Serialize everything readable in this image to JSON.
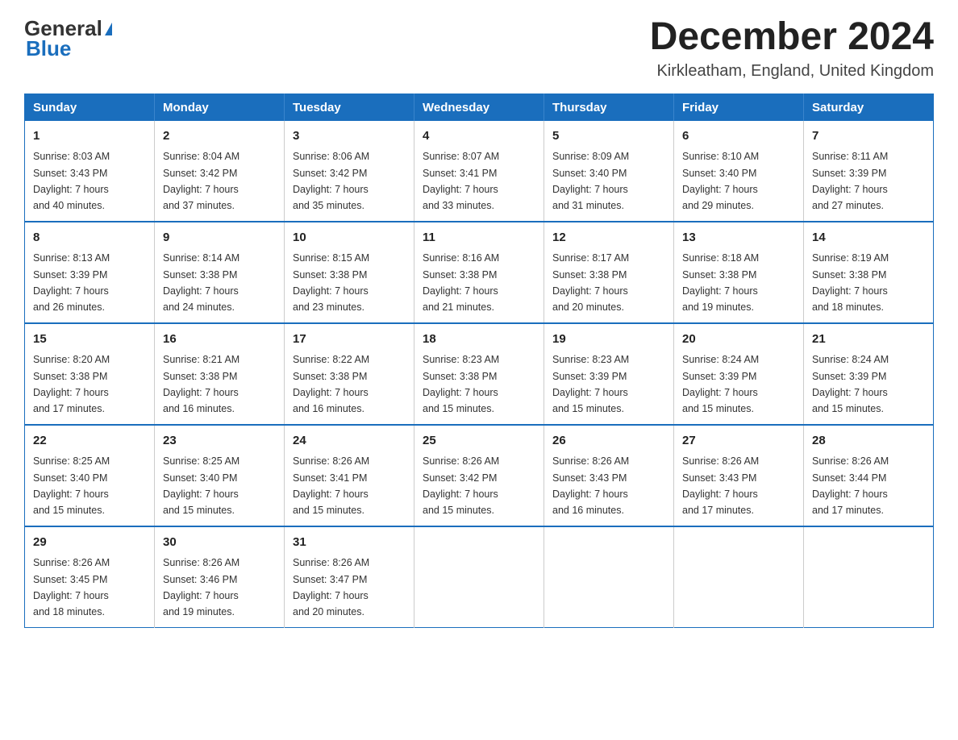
{
  "logo": {
    "general": "General",
    "blue": "Blue"
  },
  "header": {
    "month_year": "December 2024",
    "location": "Kirkleatham, England, United Kingdom"
  },
  "days_of_week": [
    "Sunday",
    "Monday",
    "Tuesday",
    "Wednesday",
    "Thursday",
    "Friday",
    "Saturday"
  ],
  "weeks": [
    [
      {
        "day": "1",
        "sunrise": "Sunrise: 8:03 AM",
        "sunset": "Sunset: 3:43 PM",
        "daylight": "Daylight: 7 hours",
        "minutes": "and 40 minutes."
      },
      {
        "day": "2",
        "sunrise": "Sunrise: 8:04 AM",
        "sunset": "Sunset: 3:42 PM",
        "daylight": "Daylight: 7 hours",
        "minutes": "and 37 minutes."
      },
      {
        "day": "3",
        "sunrise": "Sunrise: 8:06 AM",
        "sunset": "Sunset: 3:42 PM",
        "daylight": "Daylight: 7 hours",
        "minutes": "and 35 minutes."
      },
      {
        "day": "4",
        "sunrise": "Sunrise: 8:07 AM",
        "sunset": "Sunset: 3:41 PM",
        "daylight": "Daylight: 7 hours",
        "minutes": "and 33 minutes."
      },
      {
        "day": "5",
        "sunrise": "Sunrise: 8:09 AM",
        "sunset": "Sunset: 3:40 PM",
        "daylight": "Daylight: 7 hours",
        "minutes": "and 31 minutes."
      },
      {
        "day": "6",
        "sunrise": "Sunrise: 8:10 AM",
        "sunset": "Sunset: 3:40 PM",
        "daylight": "Daylight: 7 hours",
        "minutes": "and 29 minutes."
      },
      {
        "day": "7",
        "sunrise": "Sunrise: 8:11 AM",
        "sunset": "Sunset: 3:39 PM",
        "daylight": "Daylight: 7 hours",
        "minutes": "and 27 minutes."
      }
    ],
    [
      {
        "day": "8",
        "sunrise": "Sunrise: 8:13 AM",
        "sunset": "Sunset: 3:39 PM",
        "daylight": "Daylight: 7 hours",
        "minutes": "and 26 minutes."
      },
      {
        "day": "9",
        "sunrise": "Sunrise: 8:14 AM",
        "sunset": "Sunset: 3:38 PM",
        "daylight": "Daylight: 7 hours",
        "minutes": "and 24 minutes."
      },
      {
        "day": "10",
        "sunrise": "Sunrise: 8:15 AM",
        "sunset": "Sunset: 3:38 PM",
        "daylight": "Daylight: 7 hours",
        "minutes": "and 23 minutes."
      },
      {
        "day": "11",
        "sunrise": "Sunrise: 8:16 AM",
        "sunset": "Sunset: 3:38 PM",
        "daylight": "Daylight: 7 hours",
        "minutes": "and 21 minutes."
      },
      {
        "day": "12",
        "sunrise": "Sunrise: 8:17 AM",
        "sunset": "Sunset: 3:38 PM",
        "daylight": "Daylight: 7 hours",
        "minutes": "and 20 minutes."
      },
      {
        "day": "13",
        "sunrise": "Sunrise: 8:18 AM",
        "sunset": "Sunset: 3:38 PM",
        "daylight": "Daylight: 7 hours",
        "minutes": "and 19 minutes."
      },
      {
        "day": "14",
        "sunrise": "Sunrise: 8:19 AM",
        "sunset": "Sunset: 3:38 PM",
        "daylight": "Daylight: 7 hours",
        "minutes": "and 18 minutes."
      }
    ],
    [
      {
        "day": "15",
        "sunrise": "Sunrise: 8:20 AM",
        "sunset": "Sunset: 3:38 PM",
        "daylight": "Daylight: 7 hours",
        "minutes": "and 17 minutes."
      },
      {
        "day": "16",
        "sunrise": "Sunrise: 8:21 AM",
        "sunset": "Sunset: 3:38 PM",
        "daylight": "Daylight: 7 hours",
        "minutes": "and 16 minutes."
      },
      {
        "day": "17",
        "sunrise": "Sunrise: 8:22 AM",
        "sunset": "Sunset: 3:38 PM",
        "daylight": "Daylight: 7 hours",
        "minutes": "and 16 minutes."
      },
      {
        "day": "18",
        "sunrise": "Sunrise: 8:23 AM",
        "sunset": "Sunset: 3:38 PM",
        "daylight": "Daylight: 7 hours",
        "minutes": "and 15 minutes."
      },
      {
        "day": "19",
        "sunrise": "Sunrise: 8:23 AM",
        "sunset": "Sunset: 3:39 PM",
        "daylight": "Daylight: 7 hours",
        "minutes": "and 15 minutes."
      },
      {
        "day": "20",
        "sunrise": "Sunrise: 8:24 AM",
        "sunset": "Sunset: 3:39 PM",
        "daylight": "Daylight: 7 hours",
        "minutes": "and 15 minutes."
      },
      {
        "day": "21",
        "sunrise": "Sunrise: 8:24 AM",
        "sunset": "Sunset: 3:39 PM",
        "daylight": "Daylight: 7 hours",
        "minutes": "and 15 minutes."
      }
    ],
    [
      {
        "day": "22",
        "sunrise": "Sunrise: 8:25 AM",
        "sunset": "Sunset: 3:40 PM",
        "daylight": "Daylight: 7 hours",
        "minutes": "and 15 minutes."
      },
      {
        "day": "23",
        "sunrise": "Sunrise: 8:25 AM",
        "sunset": "Sunset: 3:40 PM",
        "daylight": "Daylight: 7 hours",
        "minutes": "and 15 minutes."
      },
      {
        "day": "24",
        "sunrise": "Sunrise: 8:26 AM",
        "sunset": "Sunset: 3:41 PM",
        "daylight": "Daylight: 7 hours",
        "minutes": "and 15 minutes."
      },
      {
        "day": "25",
        "sunrise": "Sunrise: 8:26 AM",
        "sunset": "Sunset: 3:42 PM",
        "daylight": "Daylight: 7 hours",
        "minutes": "and 15 minutes."
      },
      {
        "day": "26",
        "sunrise": "Sunrise: 8:26 AM",
        "sunset": "Sunset: 3:43 PM",
        "daylight": "Daylight: 7 hours",
        "minutes": "and 16 minutes."
      },
      {
        "day": "27",
        "sunrise": "Sunrise: 8:26 AM",
        "sunset": "Sunset: 3:43 PM",
        "daylight": "Daylight: 7 hours",
        "minutes": "and 17 minutes."
      },
      {
        "day": "28",
        "sunrise": "Sunrise: 8:26 AM",
        "sunset": "Sunset: 3:44 PM",
        "daylight": "Daylight: 7 hours",
        "minutes": "and 17 minutes."
      }
    ],
    [
      {
        "day": "29",
        "sunrise": "Sunrise: 8:26 AM",
        "sunset": "Sunset: 3:45 PM",
        "daylight": "Daylight: 7 hours",
        "minutes": "and 18 minutes."
      },
      {
        "day": "30",
        "sunrise": "Sunrise: 8:26 AM",
        "sunset": "Sunset: 3:46 PM",
        "daylight": "Daylight: 7 hours",
        "minutes": "and 19 minutes."
      },
      {
        "day": "31",
        "sunrise": "Sunrise: 8:26 AM",
        "sunset": "Sunset: 3:47 PM",
        "daylight": "Daylight: 7 hours",
        "minutes": "and 20 minutes."
      },
      null,
      null,
      null,
      null
    ]
  ]
}
